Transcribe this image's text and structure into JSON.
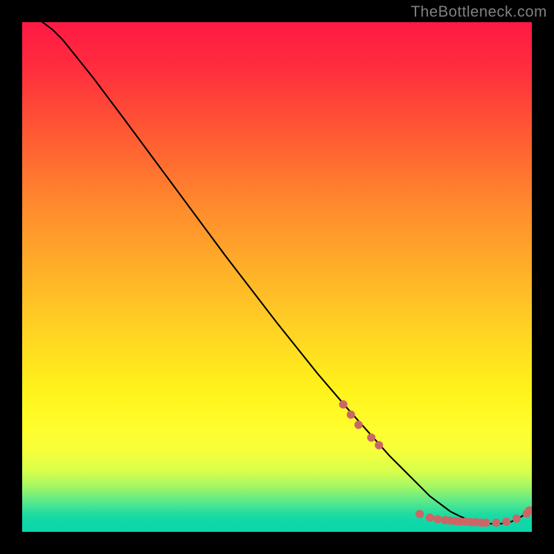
{
  "watermark": "TheBottleneck.com",
  "chart_data": {
    "type": "line",
    "title": "",
    "xlabel": "",
    "ylabel": "",
    "xlim": [
      0,
      100
    ],
    "ylim": [
      0,
      100
    ],
    "curve": {
      "name": "bottleneck-curve",
      "x": [
        4,
        6,
        8,
        10,
        14,
        20,
        30,
        40,
        50,
        58,
        64,
        68,
        72,
        74,
        76,
        78,
        80,
        82,
        84,
        86,
        88,
        90,
        92,
        94,
        96,
        98,
        99.5
      ],
      "y": [
        100,
        98.5,
        96.5,
        94,
        89,
        81,
        67.5,
        54,
        41,
        31,
        24,
        19.5,
        15,
        13,
        11,
        9,
        7,
        5.5,
        4,
        3,
        2.2,
        1.8,
        1.6,
        1.6,
        2.0,
        3.0,
        4.2
      ]
    },
    "markers": {
      "name": "highlight-points",
      "color": "#cc6666",
      "radius_px": 6,
      "x": [
        63,
        64.5,
        66,
        68.5,
        70,
        78,
        80,
        81.5,
        83,
        84,
        85,
        86,
        87,
        88,
        89,
        90,
        91,
        93,
        95,
        97,
        99,
        99.5
      ],
      "y": [
        25,
        23,
        21,
        18.5,
        17,
        3.5,
        2.8,
        2.5,
        2.3,
        2.2,
        2.1,
        2.0,
        2.0,
        1.9,
        1.9,
        1.8,
        1.8,
        1.8,
        2.0,
        2.6,
        3.6,
        4.2
      ]
    }
  }
}
